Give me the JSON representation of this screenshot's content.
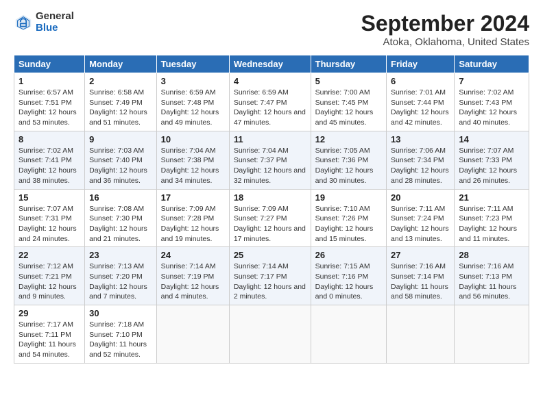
{
  "header": {
    "logo_general": "General",
    "logo_blue": "Blue",
    "month_title": "September 2024",
    "location": "Atoka, Oklahoma, United States"
  },
  "columns": [
    "Sunday",
    "Monday",
    "Tuesday",
    "Wednesday",
    "Thursday",
    "Friday",
    "Saturday"
  ],
  "weeks": [
    [
      {
        "day": "1",
        "rise": "Sunrise: 6:57 AM",
        "set": "Sunset: 7:51 PM",
        "daylight": "Daylight: 12 hours and 53 minutes."
      },
      {
        "day": "2",
        "rise": "Sunrise: 6:58 AM",
        "set": "Sunset: 7:49 PM",
        "daylight": "Daylight: 12 hours and 51 minutes."
      },
      {
        "day": "3",
        "rise": "Sunrise: 6:59 AM",
        "set": "Sunset: 7:48 PM",
        "daylight": "Daylight: 12 hours and 49 minutes."
      },
      {
        "day": "4",
        "rise": "Sunrise: 6:59 AM",
        "set": "Sunset: 7:47 PM",
        "daylight": "Daylight: 12 hours and 47 minutes."
      },
      {
        "day": "5",
        "rise": "Sunrise: 7:00 AM",
        "set": "Sunset: 7:45 PM",
        "daylight": "Daylight: 12 hours and 45 minutes."
      },
      {
        "day": "6",
        "rise": "Sunrise: 7:01 AM",
        "set": "Sunset: 7:44 PM",
        "daylight": "Daylight: 12 hours and 42 minutes."
      },
      {
        "day": "7",
        "rise": "Sunrise: 7:02 AM",
        "set": "Sunset: 7:43 PM",
        "daylight": "Daylight: 12 hours and 40 minutes."
      }
    ],
    [
      {
        "day": "8",
        "rise": "Sunrise: 7:02 AM",
        "set": "Sunset: 7:41 PM",
        "daylight": "Daylight: 12 hours and 38 minutes."
      },
      {
        "day": "9",
        "rise": "Sunrise: 7:03 AM",
        "set": "Sunset: 7:40 PM",
        "daylight": "Daylight: 12 hours and 36 minutes."
      },
      {
        "day": "10",
        "rise": "Sunrise: 7:04 AM",
        "set": "Sunset: 7:38 PM",
        "daylight": "Daylight: 12 hours and 34 minutes."
      },
      {
        "day": "11",
        "rise": "Sunrise: 7:04 AM",
        "set": "Sunset: 7:37 PM",
        "daylight": "Daylight: 12 hours and 32 minutes."
      },
      {
        "day": "12",
        "rise": "Sunrise: 7:05 AM",
        "set": "Sunset: 7:36 PM",
        "daylight": "Daylight: 12 hours and 30 minutes."
      },
      {
        "day": "13",
        "rise": "Sunrise: 7:06 AM",
        "set": "Sunset: 7:34 PM",
        "daylight": "Daylight: 12 hours and 28 minutes."
      },
      {
        "day": "14",
        "rise": "Sunrise: 7:07 AM",
        "set": "Sunset: 7:33 PM",
        "daylight": "Daylight: 12 hours and 26 minutes."
      }
    ],
    [
      {
        "day": "15",
        "rise": "Sunrise: 7:07 AM",
        "set": "Sunset: 7:31 PM",
        "daylight": "Daylight: 12 hours and 24 minutes."
      },
      {
        "day": "16",
        "rise": "Sunrise: 7:08 AM",
        "set": "Sunset: 7:30 PM",
        "daylight": "Daylight: 12 hours and 21 minutes."
      },
      {
        "day": "17",
        "rise": "Sunrise: 7:09 AM",
        "set": "Sunset: 7:28 PM",
        "daylight": "Daylight: 12 hours and 19 minutes."
      },
      {
        "day": "18",
        "rise": "Sunrise: 7:09 AM",
        "set": "Sunset: 7:27 PM",
        "daylight": "Daylight: 12 hours and 17 minutes."
      },
      {
        "day": "19",
        "rise": "Sunrise: 7:10 AM",
        "set": "Sunset: 7:26 PM",
        "daylight": "Daylight: 12 hours and 15 minutes."
      },
      {
        "day": "20",
        "rise": "Sunrise: 7:11 AM",
        "set": "Sunset: 7:24 PM",
        "daylight": "Daylight: 12 hours and 13 minutes."
      },
      {
        "day": "21",
        "rise": "Sunrise: 7:11 AM",
        "set": "Sunset: 7:23 PM",
        "daylight": "Daylight: 12 hours and 11 minutes."
      }
    ],
    [
      {
        "day": "22",
        "rise": "Sunrise: 7:12 AM",
        "set": "Sunset: 7:21 PM",
        "daylight": "Daylight: 12 hours and 9 minutes."
      },
      {
        "day": "23",
        "rise": "Sunrise: 7:13 AM",
        "set": "Sunset: 7:20 PM",
        "daylight": "Daylight: 12 hours and 7 minutes."
      },
      {
        "day": "24",
        "rise": "Sunrise: 7:14 AM",
        "set": "Sunset: 7:19 PM",
        "daylight": "Daylight: 12 hours and 4 minutes."
      },
      {
        "day": "25",
        "rise": "Sunrise: 7:14 AM",
        "set": "Sunset: 7:17 PM",
        "daylight": "Daylight: 12 hours and 2 minutes."
      },
      {
        "day": "26",
        "rise": "Sunrise: 7:15 AM",
        "set": "Sunset: 7:16 PM",
        "daylight": "Daylight: 12 hours and 0 minutes."
      },
      {
        "day": "27",
        "rise": "Sunrise: 7:16 AM",
        "set": "Sunset: 7:14 PM",
        "daylight": "Daylight: 11 hours and 58 minutes."
      },
      {
        "day": "28",
        "rise": "Sunrise: 7:16 AM",
        "set": "Sunset: 7:13 PM",
        "daylight": "Daylight: 11 hours and 56 minutes."
      }
    ],
    [
      {
        "day": "29",
        "rise": "Sunrise: 7:17 AM",
        "set": "Sunset: 7:11 PM",
        "daylight": "Daylight: 11 hours and 54 minutes."
      },
      {
        "day": "30",
        "rise": "Sunrise: 7:18 AM",
        "set": "Sunset: 7:10 PM",
        "daylight": "Daylight: 11 hours and 52 minutes."
      },
      null,
      null,
      null,
      null,
      null
    ]
  ]
}
